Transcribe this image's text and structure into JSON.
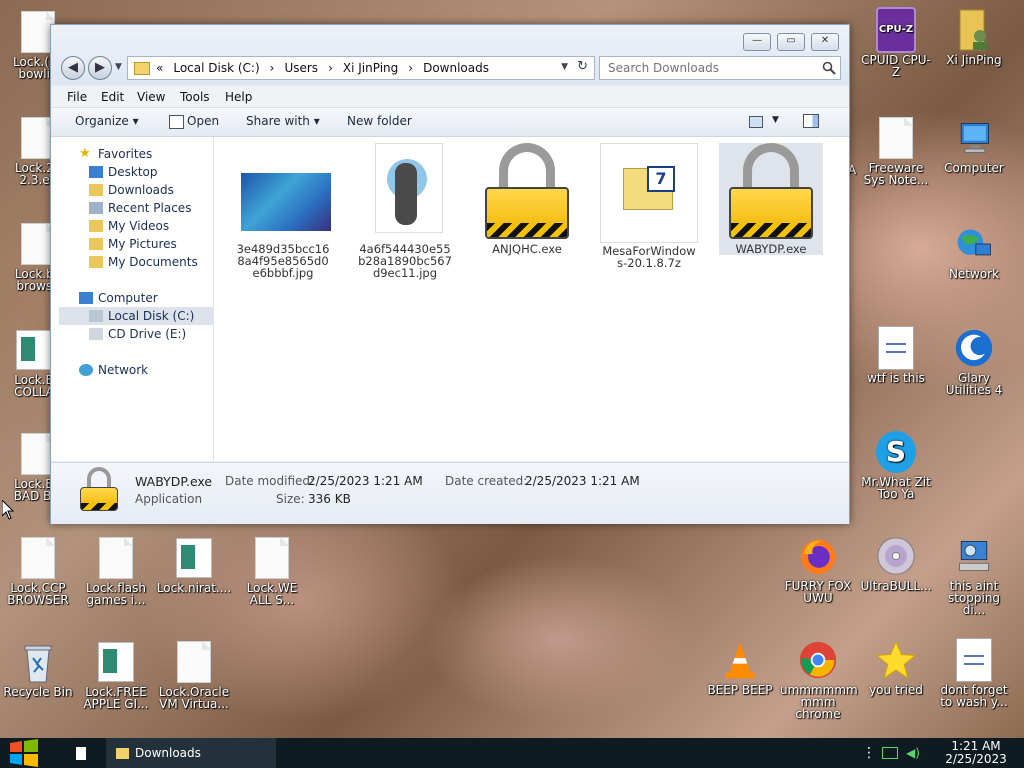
{
  "desktop": {
    "icons": [
      {
        "id": "lock1",
        "label": "Lock.(((( bowlin",
        "kind": "page"
      },
      {
        "id": "lock2",
        "label": "Lock.2P 2.3.ex",
        "kind": "page"
      },
      {
        "id": "lock3",
        "label": "Lock.ba browse",
        "kind": "page"
      },
      {
        "id": "lock4",
        "label": "Lock.B COLLA",
        "kind": "gdoc"
      },
      {
        "id": "lock5",
        "label": "Lock.BR BAD BIT",
        "kind": "page"
      },
      {
        "id": "ccp",
        "label": "Lock.CCP BROWSER",
        "kind": "page"
      },
      {
        "id": "flash",
        "label": "Lock.flash games i...",
        "kind": "page"
      },
      {
        "id": "nirat",
        "label": "Lock.nirat....",
        "kind": "gdoc"
      },
      {
        "id": "weall",
        "label": "Lock.WE ALL S...",
        "kind": "page"
      },
      {
        "id": "recycle",
        "label": "Recycle Bin",
        "kind": "recycle"
      },
      {
        "id": "freeapple",
        "label": "Lock.FREE APPLE GI...",
        "kind": "gdoc"
      },
      {
        "id": "oracle",
        "label": "Lock.Oracle VM Virtua...",
        "kind": "page"
      },
      {
        "id": "cpuz",
        "label": "CPUID CPU-Z",
        "kind": "cpuz"
      },
      {
        "id": "xiuser",
        "label": "Xi JinPing",
        "kind": "user"
      },
      {
        "id": "freeware",
        "label": "Freeware Sys Note...",
        "kind": "page"
      },
      {
        "id": "computer",
        "label": "Computer",
        "kind": "computer"
      },
      {
        "id": "network",
        "label": "Network",
        "kind": "network"
      },
      {
        "id": "wtf",
        "label": "wtf is this",
        "kind": "doc"
      },
      {
        "id": "glary",
        "label": "Glary Utilities 4",
        "kind": "glary"
      },
      {
        "id": "skype",
        "label": "Mr.What Zit Too Ya",
        "kind": "skype"
      },
      {
        "id": "firefox",
        "label": "FURRY FOX UWU",
        "kind": "firefox"
      },
      {
        "id": "ultrabull",
        "label": "UltraBULL...",
        "kind": "disc"
      },
      {
        "id": "thisaint",
        "label": "this aint stopping di...",
        "kind": "pcsetup"
      },
      {
        "id": "beep",
        "label": "BEEP BEEP",
        "kind": "vlc"
      },
      {
        "id": "chrome",
        "label": "ummmmmm mmm chrome",
        "kind": "chrome"
      },
      {
        "id": "youtried",
        "label": "you tried",
        "kind": "star"
      },
      {
        "id": "dontforget",
        "label": "dont forget to wash y...",
        "kind": "doc"
      }
    ],
    "partial_label": "A"
  },
  "explorer": {
    "window_buttons": {
      "minimize": "—",
      "maximize": "▭",
      "close": "✕"
    },
    "breadcrumb": [
      "«",
      "Local Disk (C:)",
      "›",
      "Users",
      "›",
      "Xi JinPing",
      "›",
      "Downloads"
    ],
    "search_placeholder": "Search Downloads",
    "menu": [
      "File",
      "Edit",
      "View",
      "Tools",
      "Help"
    ],
    "toolbar": {
      "organize": "Organize ▾",
      "open": "Open",
      "share": "Share with ▾",
      "newfolder": "New folder"
    },
    "nav": {
      "favorites": "Favorites",
      "fav_items": [
        "Desktop",
        "Downloads",
        "Recent Places",
        "My Videos",
        "My Pictures",
        "My Documents"
      ],
      "computer": "Computer",
      "computer_items": [
        "Local Disk (C:)",
        "CD Drive (E:)"
      ],
      "network": "Network"
    },
    "files": [
      {
        "name": "3e489d35bcc168a4f95e8565d0e6bbbf.jpg",
        "lines": [
          "3e489d35bcc16",
          "8a4f95e8565d0",
          "e6bbbf.jpg"
        ]
      },
      {
        "name": "4a6f544430e55b28a1890bc567d9ec11.jpg",
        "lines": [
          "4a6f544430e55",
          "b28a1890bc567",
          "d9ec11.jpg"
        ]
      },
      {
        "name": "ANJQHC.exe",
        "lines": [
          "ANJQHC.exe"
        ]
      },
      {
        "name": "MesaForWindows-20.1.8.7z",
        "lines": [
          "MesaForWindow",
          "s-20.1.8.7z"
        ]
      },
      {
        "name": "WABYDP.exe",
        "lines": [
          "WABYDP.exe"
        ]
      }
    ],
    "details": {
      "name": "WABYDP.exe",
      "type": "Application",
      "modified_label": "Date modified:",
      "modified": "2/25/2023 1:21 AM",
      "created_label": "Date created:",
      "created": "2/25/2023 1:21 AM",
      "size_label": "Size:",
      "size": "336 KB"
    }
  },
  "taskbar": {
    "task": "Downloads",
    "time": "1:21 AM",
    "date": "2/25/2023"
  }
}
